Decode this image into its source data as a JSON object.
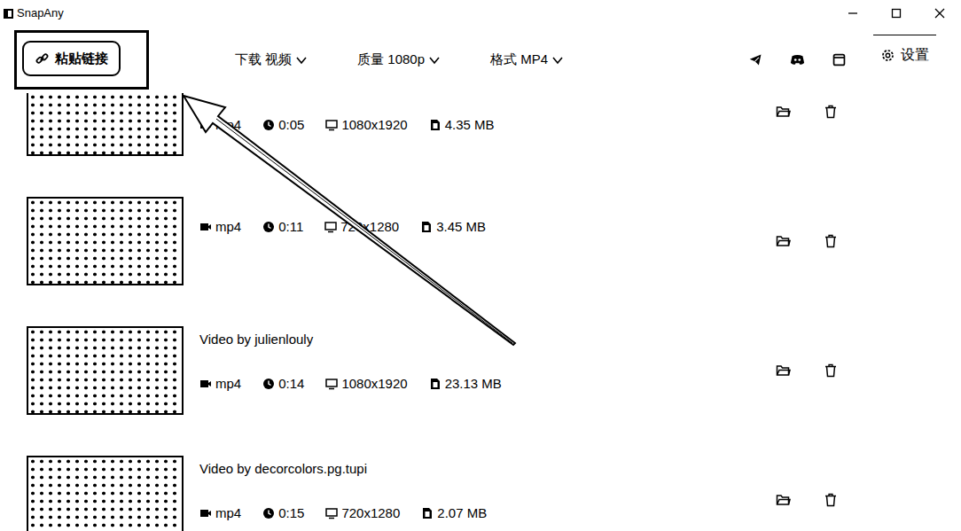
{
  "window": {
    "title": "SnapAny"
  },
  "toolbar": {
    "paste_button": {
      "label": "粘贴链接"
    },
    "dropdowns": [
      {
        "label": "下载 视频"
      },
      {
        "label": "质量 1080p"
      },
      {
        "label": "格式 MP4"
      }
    ],
    "settings_label": "设置"
  },
  "videos": [
    {
      "title": "",
      "format": "mp4",
      "duration": "0:05",
      "resolution": "1080x1920",
      "size": "4.35 MB"
    },
    {
      "title": "",
      "format": "mp4",
      "duration": "0:11",
      "resolution": "720x1280",
      "size": "3.45 MB"
    },
    {
      "title": "Video by julienlouly",
      "format": "mp4",
      "duration": "0:14",
      "resolution": "1080x1920",
      "size": "23.13 MB"
    },
    {
      "title": "Video by decorcolors.pg.tupi",
      "format": "mp4",
      "duration": "0:15",
      "resolution": "720x1280",
      "size": "2.07 MB"
    }
  ]
}
